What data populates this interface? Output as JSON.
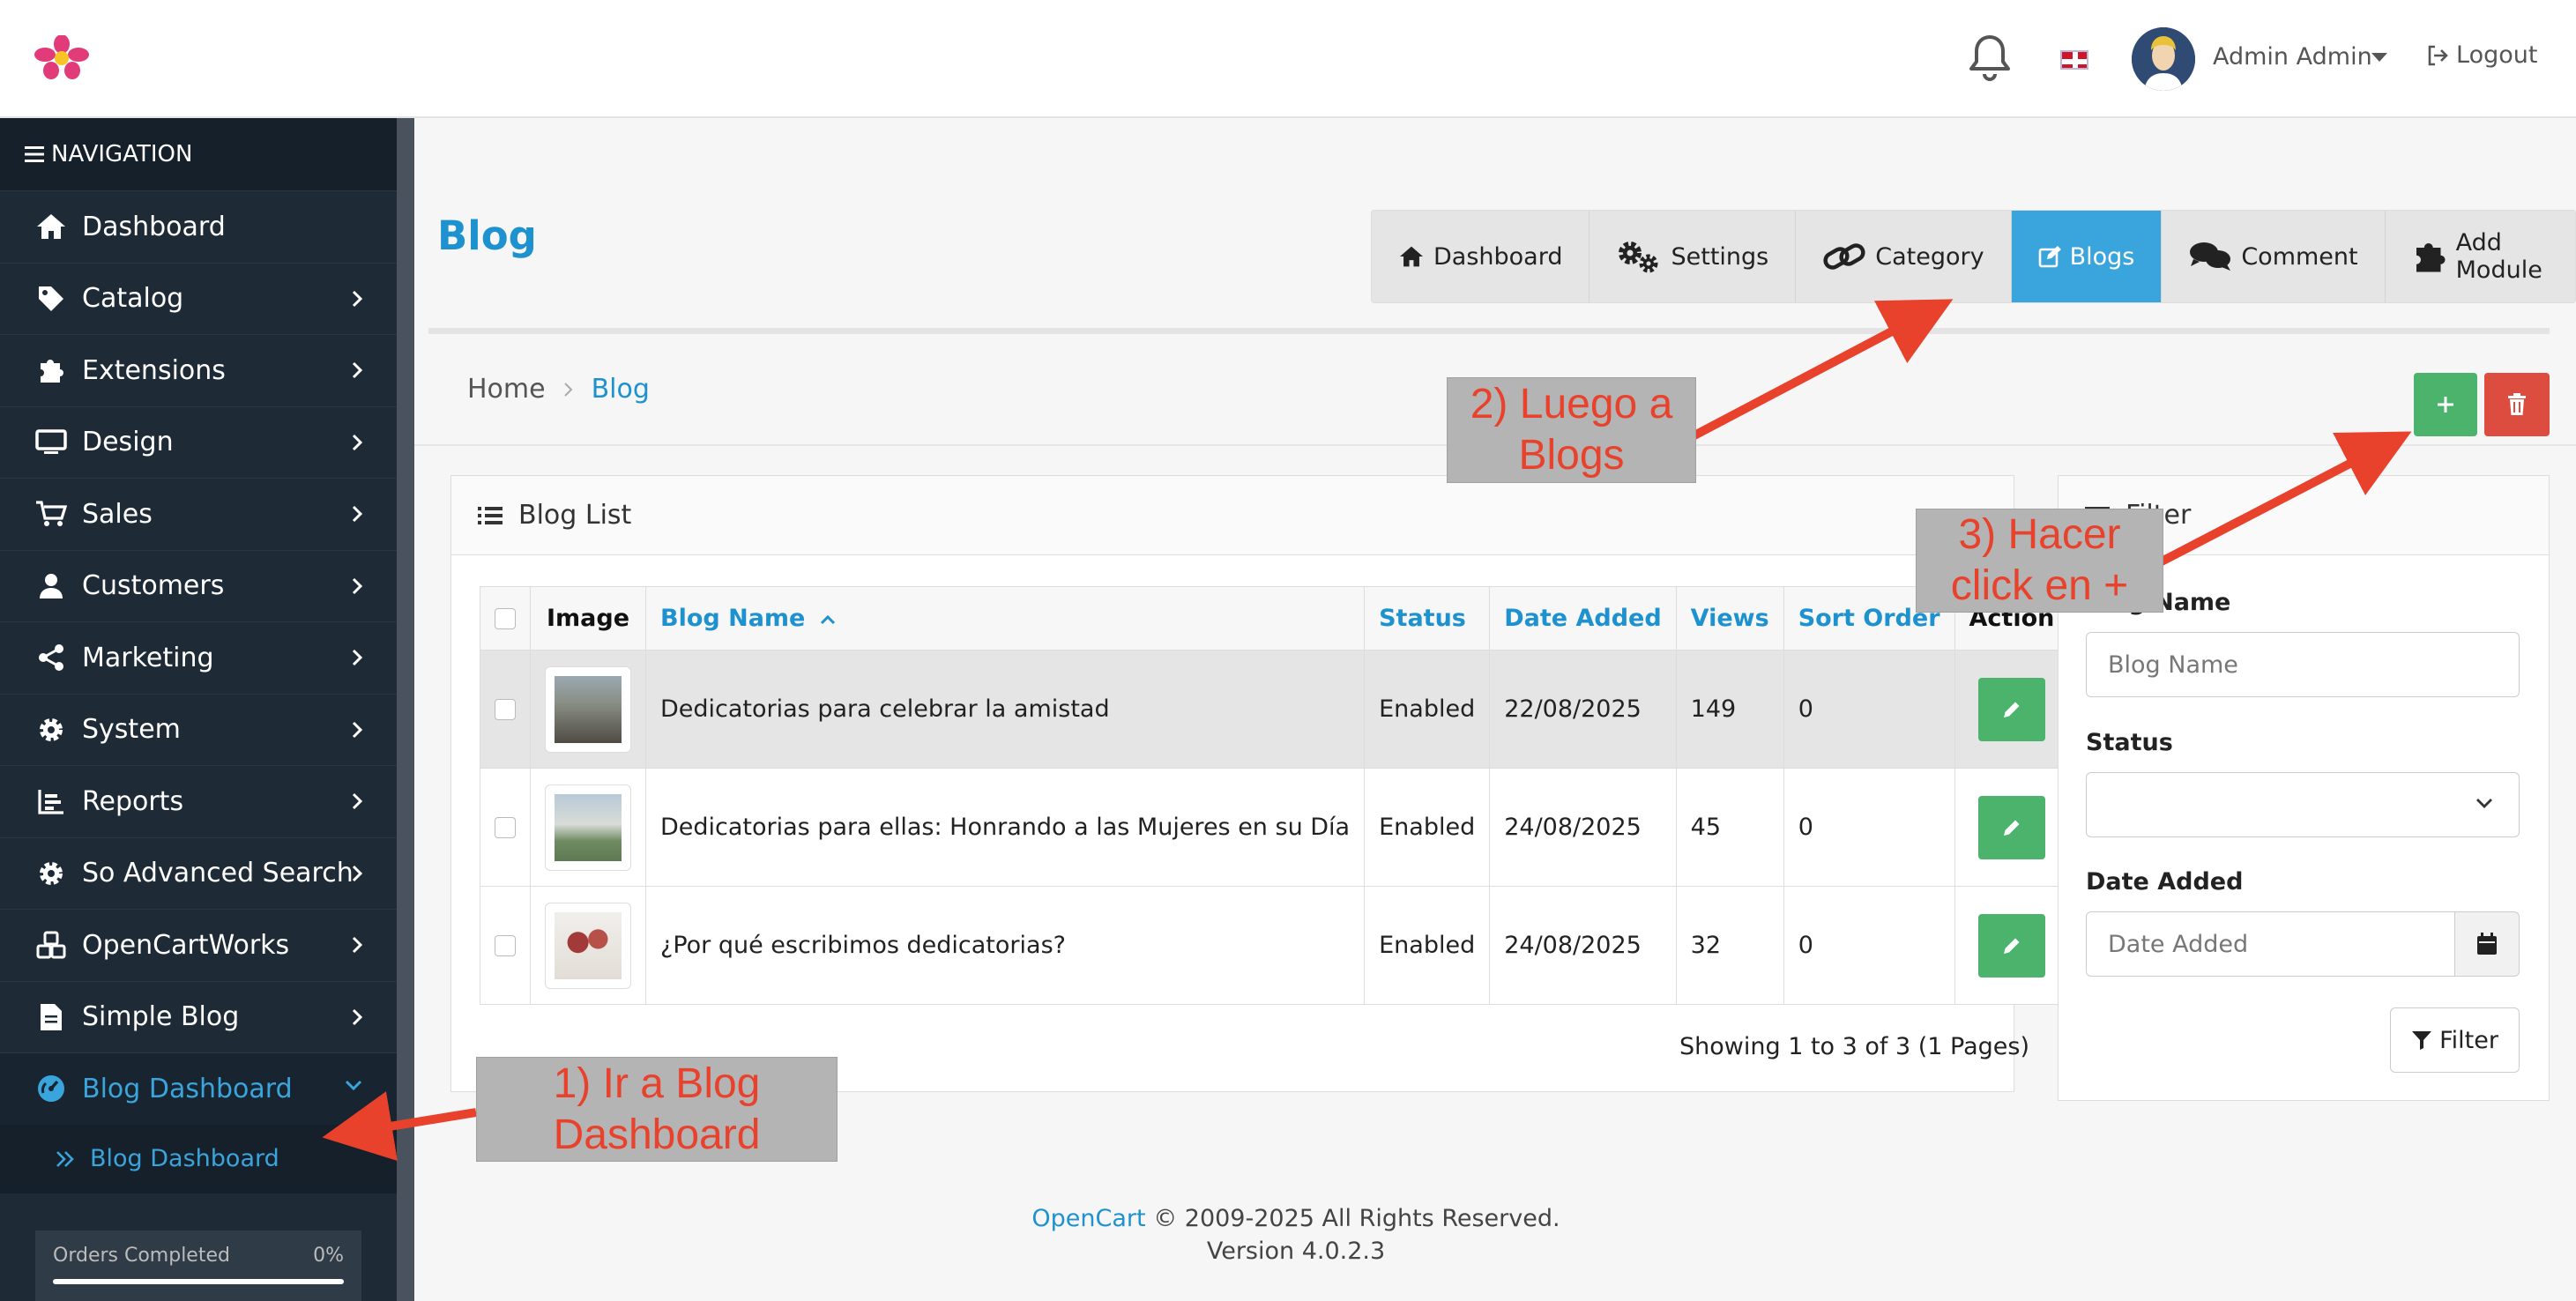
{
  "header": {
    "user_name": "Admin Admin",
    "logout_label": "Logout",
    "icons": [
      "app-logo-icon",
      "bell-icon",
      "uk-flag-icon",
      "logout-icon"
    ]
  },
  "sidebar": {
    "heading": "NAVIGATION",
    "items": [
      {
        "label": "Dashboard",
        "icon": "home-icon"
      },
      {
        "label": "Catalog",
        "icon": "tag-icon"
      },
      {
        "label": "Extensions",
        "icon": "puzzle-icon"
      },
      {
        "label": "Design",
        "icon": "monitor-icon"
      },
      {
        "label": "Sales",
        "icon": "cart-icon"
      },
      {
        "label": "Customers",
        "icon": "user-icon"
      },
      {
        "label": "Marketing",
        "icon": "share-icon"
      },
      {
        "label": "System",
        "icon": "gear-icon"
      },
      {
        "label": "Reports",
        "icon": "bar-chart-icon"
      },
      {
        "label": "So Advanced Search",
        "icon": "gear-icon"
      },
      {
        "label": "OpenCartWorks",
        "icon": "cubes-icon"
      },
      {
        "label": "Simple Blog",
        "icon": "file-icon"
      },
      {
        "label": "Blog Dashboard",
        "icon": "dashboard-icon"
      }
    ],
    "subitem": "Blog Dashboard",
    "progress": {
      "label": "Orders Completed",
      "value_label": "0%",
      "value": 0
    }
  },
  "page": {
    "title": "Blog",
    "tabs": [
      "Dashboard",
      "Settings",
      "Category",
      "Blogs",
      "Comment",
      "Add Module"
    ],
    "active_tab": "Blogs",
    "breadcrumb": [
      "Home",
      "Blog"
    ]
  },
  "blog_list": {
    "title": "Blog List",
    "columns": [
      "Image",
      "Blog Name",
      "Status",
      "Date Added",
      "Views",
      "Sort Order",
      "Action"
    ],
    "rows": [
      {
        "name": "Dedicatorias para celebrar la amistad",
        "status": "Enabled",
        "date": "22/08/2025",
        "views": "149",
        "sort": "0"
      },
      {
        "name": "Dedicatorias para ellas: Honrando a las Mujeres en su Día",
        "status": "Enabled",
        "date": "24/08/2025",
        "views": "45",
        "sort": "0"
      },
      {
        "name": "¿Por qué escribimos dedicatorias?",
        "status": "Enabled",
        "date": "24/08/2025",
        "views": "32",
        "sort": "0"
      }
    ],
    "showing": "Showing 1 to 3 of 3 (1 Pages)"
  },
  "filter": {
    "title": "Filter",
    "name_label": "Blog Name",
    "name_placeholder": "Blog Name",
    "status_label": "Status",
    "date_label": "Date Added",
    "date_placeholder": "Date Added",
    "button": "Filter"
  },
  "footer": {
    "brand": "OpenCart",
    "copyright": " © 2009-2025 All Rights Reserved.",
    "version": "Version 4.0.2.3"
  },
  "annotations": [
    {
      "line1": "1) Ir a Blog",
      "line2": "Dashboard"
    },
    {
      "line1": "2) Luego a",
      "line2": "Blogs"
    },
    {
      "line1": "3) Hacer",
      "line2": "click en +"
    }
  ],
  "colors": {
    "accent": "#1e91cf",
    "sidebar": "#1e2b37",
    "success": "#4cb36c",
    "danger": "#dc4c3f",
    "annotation": "#e8412c"
  }
}
